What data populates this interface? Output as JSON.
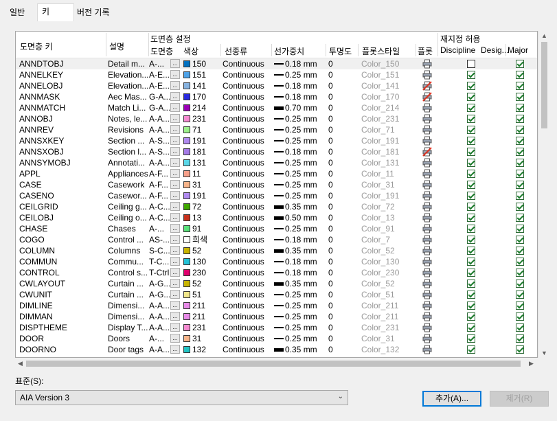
{
  "tabs": [
    "일반",
    "키",
    "버전 기록"
  ],
  "active_tab": 1,
  "columns": {
    "layer_key": "도면층 키",
    "description": "설명",
    "layer_settings": "도면층 설정",
    "layer": "도면층",
    "color": "색상",
    "linetype": "선종류",
    "lineweight": "선가중치",
    "transparency": "투명도",
    "plotstyle": "플롯스타일",
    "plot": "플롯",
    "override_group": "재지정 허용",
    "discipline": "Discipline",
    "designator": "Desig...",
    "major": "Major"
  },
  "rows": [
    {
      "key": "ANNDTOBJ",
      "desc": "Detail m...",
      "layer": "A-...",
      "color_hex": "#0070c0",
      "color": "150",
      "linetype": "Continuous",
      "lw": "0.18 mm",
      "lw_thick": false,
      "trans": "0",
      "plotstyle": "Color_150",
      "plot": true,
      "discipline": false,
      "major": true
    },
    {
      "key": "ANNELKEY",
      "desc": "Elevation...",
      "layer": "A-E...",
      "color_hex": "#4fa3e8",
      "color": "151",
      "linetype": "Continuous",
      "lw": "0.25 mm",
      "lw_thick": false,
      "trans": "0",
      "plotstyle": "Color_151",
      "plot": true,
      "discipline": true,
      "major": true
    },
    {
      "key": "ANNELOBJ",
      "desc": "Elevation...",
      "layer": "A-E...",
      "color_hex": "#87b3e0",
      "color": "141",
      "linetype": "Continuous",
      "lw": "0.18 mm",
      "lw_thick": false,
      "trans": "0",
      "plotstyle": "Color_141",
      "plot": false,
      "discipline": true,
      "major": true
    },
    {
      "key": "ANNMASK",
      "desc": "Aec Mas...",
      "layer": "G-A...",
      "color_hex": "#2a2ae0",
      "color": "170",
      "linetype": "Continuous",
      "lw": "0.18 mm",
      "lw_thick": false,
      "trans": "0",
      "plotstyle": "Color_170",
      "plot": false,
      "discipline": true,
      "major": true
    },
    {
      "key": "ANNMATCH",
      "desc": "Match Li...",
      "layer": "G-A...",
      "color_hex": "#9b00b5",
      "color": "214",
      "linetype": "Continuous",
      "lw": "0.70 mm",
      "lw_thick": true,
      "trans": "0",
      "plotstyle": "Color_214",
      "plot": true,
      "discipline": true,
      "major": true
    },
    {
      "key": "ANNOBJ",
      "desc": "Notes, le...",
      "layer": "A-A...",
      "color_hex": "#f48ad0",
      "color": "231",
      "linetype": "Continuous",
      "lw": "0.25 mm",
      "lw_thick": false,
      "trans": "0",
      "plotstyle": "Color_231",
      "plot": true,
      "discipline": true,
      "major": true
    },
    {
      "key": "ANNREV",
      "desc": "Revisions",
      "layer": "A-A...",
      "color_hex": "#9cf08a",
      "color": "71",
      "linetype": "Continuous",
      "lw": "0.25 mm",
      "lw_thick": false,
      "trans": "0",
      "plotstyle": "Color_71",
      "plot": true,
      "discipline": true,
      "major": true
    },
    {
      "key": "ANNSXKEY",
      "desc": "Section ...",
      "layer": "A-S...",
      "color_hex": "#b08af0",
      "color": "191",
      "linetype": "Continuous",
      "lw": "0.25 mm",
      "lw_thick": false,
      "trans": "0",
      "plotstyle": "Color_191",
      "plot": true,
      "discipline": true,
      "major": true
    },
    {
      "key": "ANNSXOBJ",
      "desc": "Section l...",
      "layer": "A-S...",
      "color_hex": "#a57ae8",
      "color": "181",
      "linetype": "Continuous",
      "lw": "0.18 mm",
      "lw_thick": false,
      "trans": "0",
      "plotstyle": "Color_181",
      "plot": false,
      "discipline": true,
      "major": true
    },
    {
      "key": "ANNSYMOBJ",
      "desc": "Annotati...",
      "layer": "A-A...",
      "color_hex": "#5ad7e8",
      "color": "131",
      "linetype": "Continuous",
      "lw": "0.25 mm",
      "lw_thick": false,
      "trans": "0",
      "plotstyle": "Color_131",
      "plot": true,
      "discipline": true,
      "major": true
    },
    {
      "key": "APPL",
      "desc": "Appliances",
      "layer": "A-F...",
      "color_hex": "#f7a08a",
      "color": "11",
      "linetype": "Continuous",
      "lw": "0.25 mm",
      "lw_thick": false,
      "trans": "0",
      "plotstyle": "Color_11",
      "plot": true,
      "discipline": true,
      "major": true
    },
    {
      "key": "CASE",
      "desc": "Casework",
      "layer": "A-F...",
      "color_hex": "#f7b48a",
      "color": "31",
      "linetype": "Continuous",
      "lw": "0.25 mm",
      "lw_thick": false,
      "trans": "0",
      "plotstyle": "Color_31",
      "plot": true,
      "discipline": true,
      "major": true
    },
    {
      "key": "CASENO",
      "desc": "Casewor...",
      "layer": "A-F...",
      "color_hex": "#b08af0",
      "color": "191",
      "linetype": "Continuous",
      "lw": "0.25 mm",
      "lw_thick": false,
      "trans": "0",
      "plotstyle": "Color_191",
      "plot": true,
      "discipline": true,
      "major": true
    },
    {
      "key": "CEILGRID",
      "desc": "Ceiling g...",
      "layer": "A-C...",
      "color_hex": "#3fa800",
      "color": "72",
      "linetype": "Continuous",
      "lw": "0.35 mm",
      "lw_thick": true,
      "trans": "0",
      "plotstyle": "Color_72",
      "plot": true,
      "discipline": true,
      "major": true
    },
    {
      "key": "CEILOBJ",
      "desc": "Ceiling o...",
      "layer": "A-C...",
      "color_hex": "#c8321e",
      "color": "13",
      "linetype": "Continuous",
      "lw": "0.50 mm",
      "lw_thick": true,
      "trans": "0",
      "plotstyle": "Color_13",
      "plot": true,
      "discipline": true,
      "major": true
    },
    {
      "key": "CHASE",
      "desc": "Chases",
      "layer": "A-...",
      "color_hex": "#5ae07a",
      "color": "91",
      "linetype": "Continuous",
      "lw": "0.25 mm",
      "lw_thick": false,
      "trans": "0",
      "plotstyle": "Color_91",
      "plot": true,
      "discipline": true,
      "major": true
    },
    {
      "key": "COGO",
      "desc": "Control ...",
      "layer": "AS-...",
      "color_hex": "#ffffff",
      "color": "희색",
      "linetype": "Continuous",
      "lw": "0.18 mm",
      "lw_thick": false,
      "trans": "0",
      "plotstyle": "Color_7",
      "plot": true,
      "discipline": true,
      "major": true
    },
    {
      "key": "COLUMN",
      "desc": "Columns",
      "layer": "S-C...",
      "color_hex": "#c8b400",
      "color": "52",
      "linetype": "Continuous",
      "lw": "0.35 mm",
      "lw_thick": true,
      "trans": "0",
      "plotstyle": "Color_52",
      "plot": true,
      "discipline": true,
      "major": true
    },
    {
      "key": "COMMUN",
      "desc": "Commu...",
      "layer": "T-C...",
      "color_hex": "#22c3d8",
      "color": "130",
      "linetype": "Continuous",
      "lw": "0.18 mm",
      "lw_thick": false,
      "trans": "0",
      "plotstyle": "Color_130",
      "plot": true,
      "discipline": true,
      "major": true
    },
    {
      "key": "CONTROL",
      "desc": "Control s...",
      "layer": "T-Ctrl",
      "color_hex": "#e0006e",
      "color": "230",
      "linetype": "Continuous",
      "lw": "0.18 mm",
      "lw_thick": false,
      "trans": "0",
      "plotstyle": "Color_230",
      "plot": true,
      "discipline": true,
      "major": true
    },
    {
      "key": "CWLAYOUT",
      "desc": "Curtain ...",
      "layer": "A-G...",
      "color_hex": "#c8b400",
      "color": "52",
      "linetype": "Continuous",
      "lw": "0.35 mm",
      "lw_thick": true,
      "trans": "0",
      "plotstyle": "Color_52",
      "plot": true,
      "discipline": true,
      "major": true
    },
    {
      "key": "CWUNIT",
      "desc": "Curtain ...",
      "layer": "A-G...",
      "color_hex": "#f0e68a",
      "color": "51",
      "linetype": "Continuous",
      "lw": "0.25 mm",
      "lw_thick": false,
      "trans": "0",
      "plotstyle": "Color_51",
      "plot": true,
      "discipline": true,
      "major": true
    },
    {
      "key": "DIMLINE",
      "desc": "Dimensi...",
      "layer": "A-A...",
      "color_hex": "#e88ae8",
      "color": "211",
      "linetype": "Continuous",
      "lw": "0.25 mm",
      "lw_thick": false,
      "trans": "0",
      "plotstyle": "Color_211",
      "plot": true,
      "discipline": true,
      "major": true
    },
    {
      "key": "DIMMAN",
      "desc": "Dimensi...",
      "layer": "A-A...",
      "color_hex": "#e88ae8",
      "color": "211",
      "linetype": "Continuous",
      "lw": "0.25 mm",
      "lw_thick": false,
      "trans": "0",
      "plotstyle": "Color_211",
      "plot": true,
      "discipline": true,
      "major": true
    },
    {
      "key": "DISPTHEME",
      "desc": "Display T...",
      "layer": "A-A...",
      "color_hex": "#f48ad0",
      "color": "231",
      "linetype": "Continuous",
      "lw": "0.25 mm",
      "lw_thick": false,
      "trans": "0",
      "plotstyle": "Color_231",
      "plot": true,
      "discipline": true,
      "major": true
    },
    {
      "key": "DOOR",
      "desc": "Doors",
      "layer": "A-...",
      "color_hex": "#f7b48a",
      "color": "31",
      "linetype": "Continuous",
      "lw": "0.25 mm",
      "lw_thick": false,
      "trans": "0",
      "plotstyle": "Color_31",
      "plot": true,
      "discipline": true,
      "major": true
    },
    {
      "key": "DOORNO",
      "desc": "Door tags",
      "layer": "A-A...",
      "color_hex": "#22c3c3",
      "color": "132",
      "linetype": "Continuous",
      "lw": "0.35 mm",
      "lw_thick": true,
      "trans": "0",
      "plotstyle": "Color_132",
      "plot": true,
      "discipline": true,
      "major": true
    }
  ],
  "mini_button_label": "...",
  "standard_label": "표준(S):",
  "standard_value": "AIA Version 3",
  "add_button": "추가(A)...",
  "remove_button": "제거(R)"
}
